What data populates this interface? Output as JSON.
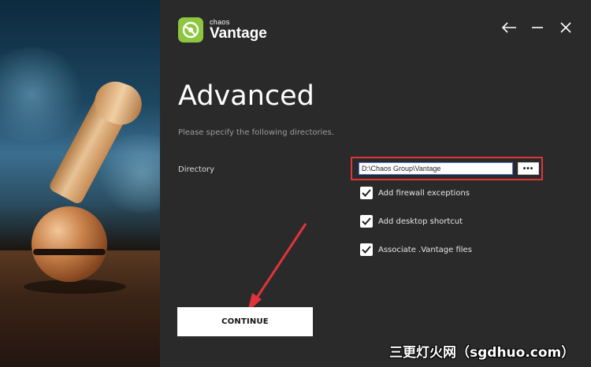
{
  "brand": {
    "small": "chaos",
    "big": "Vantage",
    "color": "#8dc63f"
  },
  "window_controls": {
    "back_icon": "arrow-left-icon",
    "minimize_icon": "minimize-icon",
    "close_icon": "close-icon"
  },
  "page": {
    "title": "Advanced",
    "subtitle": "Please specify the following directories."
  },
  "directory": {
    "label": "Directory",
    "value": "D:\\Chaos Group\\Vantage",
    "browse_label": "•••"
  },
  "options": [
    {
      "label": "Add firewall exceptions",
      "checked": true
    },
    {
      "label": "Add desktop shortcut",
      "checked": true
    },
    {
      "label": "Associate .Vantage files",
      "checked": true
    }
  ],
  "continue_label": "CONTINUE",
  "watermark": "三更灯火网（sgdhuo.com）",
  "colors": {
    "panel_bg": "#2a2a2a",
    "highlight": "#e0343a",
    "input_border": "#4a78d0"
  }
}
